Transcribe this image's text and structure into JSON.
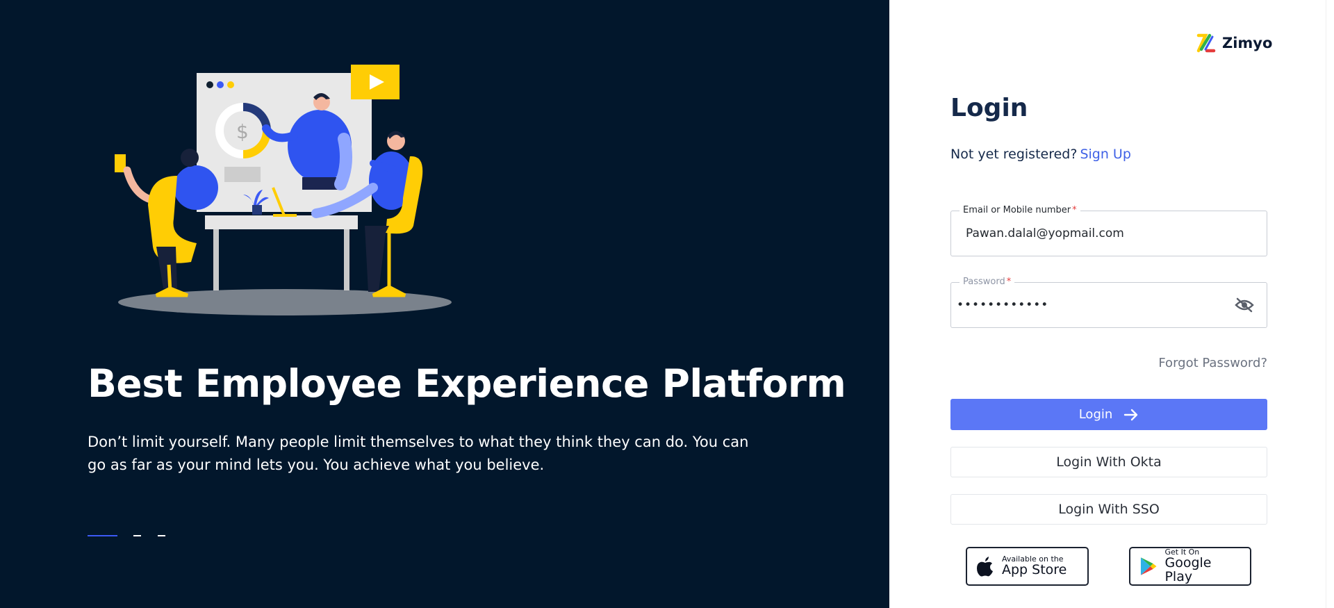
{
  "hero": {
    "title": "Best Employee Experience Platform",
    "description": "Don’t limit yourself. Many people limit themselves to what they think they can do. You can go as far as your mind lets you. You achieve what you believe.",
    "carousel": {
      "slides": 3,
      "active_index": 0
    }
  },
  "brand": {
    "name": "Zimyo"
  },
  "login": {
    "title": "Login",
    "register_prompt": "Not yet registered?",
    "signup_link": "Sign Up",
    "email": {
      "label": "Email or Mobile number",
      "required_mark": "*",
      "value": "Pawan.dalal@yopmail.com"
    },
    "password": {
      "label": "Password",
      "required_mark": "*",
      "value": "••••••••••••"
    },
    "forgot_password": "Forgot Password?",
    "login_button": "Login",
    "okta_button": "Login With Okta",
    "sso_button": "Login With SSO"
  },
  "stores": {
    "apple": {
      "small": "Available on the",
      "big": "App Store"
    },
    "google": {
      "small": "Get It On",
      "big": "Google Play"
    }
  },
  "colors": {
    "hero_bg": "#02172c",
    "primary": "#5b77f6",
    "link": "#3f61e6",
    "accent_yellow": "#ffcd05"
  }
}
